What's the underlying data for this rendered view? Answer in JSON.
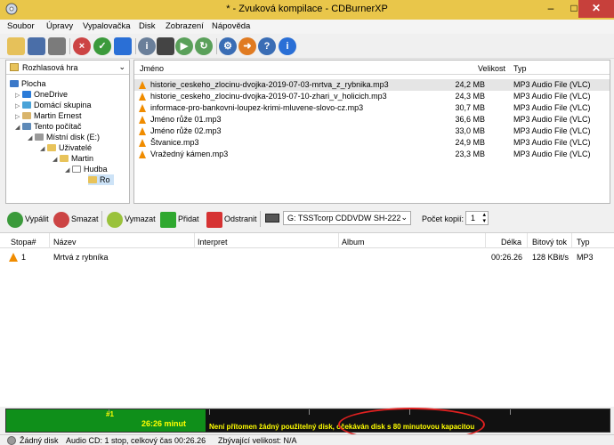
{
  "window": {
    "title": "* - Zvuková kompilace - CDBurnerXP",
    "minimize": "–",
    "maximize": "□",
    "close": "✕"
  },
  "menu": [
    "Soubor",
    "Úpravy",
    "Vypalovačka",
    "Disk",
    "Zobrazení",
    "Nápověda"
  ],
  "toolbar": {
    "icons": [
      "open-folder-icon",
      "save-icon",
      "print-icon",
      "erase-disc-icon",
      "burn-disc-icon",
      "blue-disc-icon",
      "disc-info-icon",
      "drive-icon",
      "play-icon",
      "refresh-icon",
      "settings-gear-icon",
      "share-icon",
      "help-icon",
      "info-icon"
    ],
    "glyphs": [
      "",
      "",
      "",
      "×",
      "✓",
      "",
      "i",
      "",
      "▶",
      "↻",
      "⚙",
      "➜",
      "?",
      "i"
    ]
  },
  "tree": {
    "combo_value": "Rozhlasová hra",
    "items": [
      {
        "label": "Plocha"
      },
      {
        "label": "OneDrive"
      },
      {
        "label": "Domácí skupina"
      },
      {
        "label": "Martin Ernest"
      },
      {
        "label": "Tento počítač"
      },
      {
        "label": "Místní disk (E:)"
      },
      {
        "label": "Uživatelé"
      },
      {
        "label": "Martin"
      },
      {
        "label": "Hudba"
      },
      {
        "label": "Ro"
      }
    ]
  },
  "files": {
    "headers": {
      "name": "Jméno",
      "size": "Velikost",
      "type": "Typ"
    },
    "rows": [
      {
        "name": "historie_ceskeho_zlocinu-dvojka-2019-07-03-mrtva_z_rybnika.mp3",
        "size": "24,2 MB",
        "type": "MP3 Audio File (VLC)"
      },
      {
        "name": "historie_ceskeho_zlocinu-dvojka-2019-07-10-zhari_v_holicich.mp3",
        "size": "24,3 MB",
        "type": "MP3 Audio File (VLC)"
      },
      {
        "name": "informace-pro-bankovni-loupez-krimi-mluvene-slovo-cz.mp3",
        "size": "30,7 MB",
        "type": "MP3 Audio File (VLC)"
      },
      {
        "name": "Jméno růže 01.mp3",
        "size": "36,6 MB",
        "type": "MP3 Audio File (VLC)"
      },
      {
        "name": "Jméno růže 02.mp3",
        "size": "33,0 MB",
        "type": "MP3 Audio File (VLC)"
      },
      {
        "name": "Štvanice.mp3",
        "size": "24,9 MB",
        "type": "MP3 Audio File (VLC)"
      },
      {
        "name": "Vražedný kámen.mp3",
        "size": "23,3 MB",
        "type": "MP3 Audio File (VLC)"
      }
    ]
  },
  "actions": {
    "burn": "Vypálit",
    "erase": "Smazat",
    "clear": "Vymazat",
    "add": "Přidat",
    "remove": "Odstranit",
    "drive": "G: TSSTcorp CDDVDW SH-222",
    "copies_label": "Počet kopií:",
    "copies_value": "1"
  },
  "compilation": {
    "headers": {
      "track": "Stopa#",
      "name": "Název",
      "artist": "Interpret",
      "album": "Album",
      "length": "Délka",
      "bitrate": "Bitový tok",
      "type": "Typ"
    },
    "rows": [
      {
        "track": "1",
        "name": "Mrtvá z rybníka",
        "artist": "",
        "album": "",
        "length": "00:26.26",
        "bitrate": "128 KBit/s",
        "type": "MP3"
      }
    ]
  },
  "capacity": {
    "track_label": "#1",
    "duration": "26:26 minut",
    "message": "Není přítomen žádný použitelný disk, očekáván disk s 80 minutovou kapacitou",
    "used_fraction": 0.33,
    "colors": {
      "fill": "#0f8f1a",
      "text": "#ffff00",
      "highlight_ring": "#e02020"
    }
  },
  "status": {
    "disc": "Žádný disk",
    "info": "Audio CD: 1 stop, celkový čas 00:26.26",
    "remaining": "Zbývající velikost: N/A"
  },
  "colors": {
    "titlebar": "#e9c64a",
    "close_button": "#c7403b",
    "selection": "#e5e5e5"
  }
}
